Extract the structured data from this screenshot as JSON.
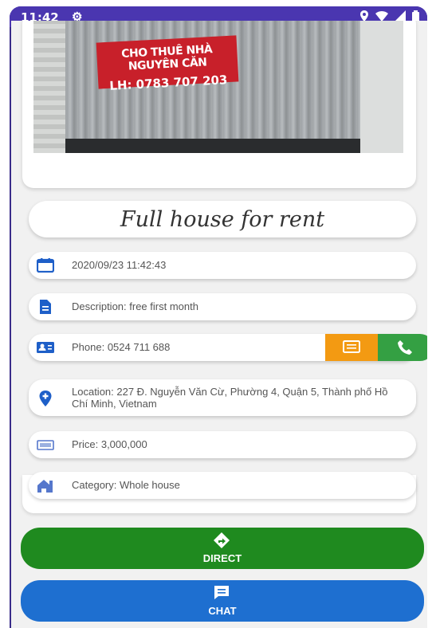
{
  "status_bar": {
    "time": "11:42",
    "icons": [
      "gear-icon",
      "location-icon",
      "wifi-icon",
      "signal-icon",
      "battery-icon"
    ]
  },
  "photo": {
    "sign_line1": "CHO THUÊ NHÀ NGUYÊN CĂN",
    "sign_line2": "LH: 0783 707 203"
  },
  "title": "Full house for rent",
  "details": {
    "date": "2020/09/23 11:42:43",
    "description": "Description: free first month",
    "phone": "Phone: 0524 711 688",
    "location": "Location: 227 Đ. Nguyễn Văn Cừ, Phường 4, Quận 5, Thành phố Hồ Chí Minh, Vietnam",
    "price": "Price: 3,000,000",
    "category": "Category: Whole house"
  },
  "actions": {
    "direct_label": "DIRECT",
    "chat_label": "CHAT"
  },
  "colors": {
    "status_bar": "#4a36b0",
    "message_button": "#f39a12",
    "call_button": "#34a043",
    "direct_button": "#1f8a1f",
    "chat_button": "#1e6fd0",
    "icon_blue": "#1e5fc8"
  }
}
